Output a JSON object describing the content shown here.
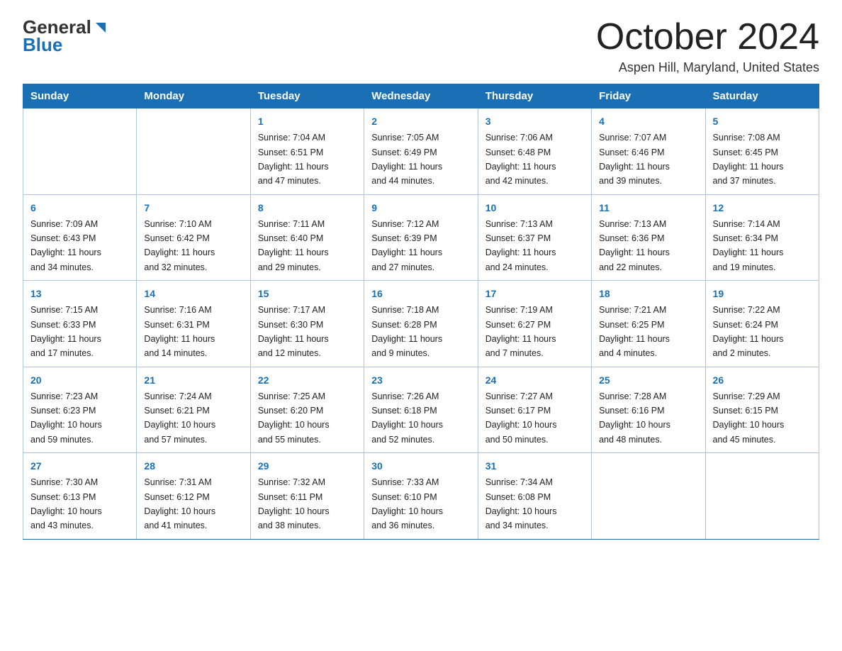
{
  "header": {
    "logo_general": "General",
    "logo_blue": "Blue",
    "month_title": "October 2024",
    "location": "Aspen Hill, Maryland, United States"
  },
  "days_of_week": [
    "Sunday",
    "Monday",
    "Tuesday",
    "Wednesday",
    "Thursday",
    "Friday",
    "Saturday"
  ],
  "weeks": [
    [
      {
        "day": "",
        "info": ""
      },
      {
        "day": "",
        "info": ""
      },
      {
        "day": "1",
        "info": "Sunrise: 7:04 AM\nSunset: 6:51 PM\nDaylight: 11 hours\nand 47 minutes."
      },
      {
        "day": "2",
        "info": "Sunrise: 7:05 AM\nSunset: 6:49 PM\nDaylight: 11 hours\nand 44 minutes."
      },
      {
        "day": "3",
        "info": "Sunrise: 7:06 AM\nSunset: 6:48 PM\nDaylight: 11 hours\nand 42 minutes."
      },
      {
        "day": "4",
        "info": "Sunrise: 7:07 AM\nSunset: 6:46 PM\nDaylight: 11 hours\nand 39 minutes."
      },
      {
        "day": "5",
        "info": "Sunrise: 7:08 AM\nSunset: 6:45 PM\nDaylight: 11 hours\nand 37 minutes."
      }
    ],
    [
      {
        "day": "6",
        "info": "Sunrise: 7:09 AM\nSunset: 6:43 PM\nDaylight: 11 hours\nand 34 minutes."
      },
      {
        "day": "7",
        "info": "Sunrise: 7:10 AM\nSunset: 6:42 PM\nDaylight: 11 hours\nand 32 minutes."
      },
      {
        "day": "8",
        "info": "Sunrise: 7:11 AM\nSunset: 6:40 PM\nDaylight: 11 hours\nand 29 minutes."
      },
      {
        "day": "9",
        "info": "Sunrise: 7:12 AM\nSunset: 6:39 PM\nDaylight: 11 hours\nand 27 minutes."
      },
      {
        "day": "10",
        "info": "Sunrise: 7:13 AM\nSunset: 6:37 PM\nDaylight: 11 hours\nand 24 minutes."
      },
      {
        "day": "11",
        "info": "Sunrise: 7:13 AM\nSunset: 6:36 PM\nDaylight: 11 hours\nand 22 minutes."
      },
      {
        "day": "12",
        "info": "Sunrise: 7:14 AM\nSunset: 6:34 PM\nDaylight: 11 hours\nand 19 minutes."
      }
    ],
    [
      {
        "day": "13",
        "info": "Sunrise: 7:15 AM\nSunset: 6:33 PM\nDaylight: 11 hours\nand 17 minutes."
      },
      {
        "day": "14",
        "info": "Sunrise: 7:16 AM\nSunset: 6:31 PM\nDaylight: 11 hours\nand 14 minutes."
      },
      {
        "day": "15",
        "info": "Sunrise: 7:17 AM\nSunset: 6:30 PM\nDaylight: 11 hours\nand 12 minutes."
      },
      {
        "day": "16",
        "info": "Sunrise: 7:18 AM\nSunset: 6:28 PM\nDaylight: 11 hours\nand 9 minutes."
      },
      {
        "day": "17",
        "info": "Sunrise: 7:19 AM\nSunset: 6:27 PM\nDaylight: 11 hours\nand 7 minutes."
      },
      {
        "day": "18",
        "info": "Sunrise: 7:21 AM\nSunset: 6:25 PM\nDaylight: 11 hours\nand 4 minutes."
      },
      {
        "day": "19",
        "info": "Sunrise: 7:22 AM\nSunset: 6:24 PM\nDaylight: 11 hours\nand 2 minutes."
      }
    ],
    [
      {
        "day": "20",
        "info": "Sunrise: 7:23 AM\nSunset: 6:23 PM\nDaylight: 10 hours\nand 59 minutes."
      },
      {
        "day": "21",
        "info": "Sunrise: 7:24 AM\nSunset: 6:21 PM\nDaylight: 10 hours\nand 57 minutes."
      },
      {
        "day": "22",
        "info": "Sunrise: 7:25 AM\nSunset: 6:20 PM\nDaylight: 10 hours\nand 55 minutes."
      },
      {
        "day": "23",
        "info": "Sunrise: 7:26 AM\nSunset: 6:18 PM\nDaylight: 10 hours\nand 52 minutes."
      },
      {
        "day": "24",
        "info": "Sunrise: 7:27 AM\nSunset: 6:17 PM\nDaylight: 10 hours\nand 50 minutes."
      },
      {
        "day": "25",
        "info": "Sunrise: 7:28 AM\nSunset: 6:16 PM\nDaylight: 10 hours\nand 48 minutes."
      },
      {
        "day": "26",
        "info": "Sunrise: 7:29 AM\nSunset: 6:15 PM\nDaylight: 10 hours\nand 45 minutes."
      }
    ],
    [
      {
        "day": "27",
        "info": "Sunrise: 7:30 AM\nSunset: 6:13 PM\nDaylight: 10 hours\nand 43 minutes."
      },
      {
        "day": "28",
        "info": "Sunrise: 7:31 AM\nSunset: 6:12 PM\nDaylight: 10 hours\nand 41 minutes."
      },
      {
        "day": "29",
        "info": "Sunrise: 7:32 AM\nSunset: 6:11 PM\nDaylight: 10 hours\nand 38 minutes."
      },
      {
        "day": "30",
        "info": "Sunrise: 7:33 AM\nSunset: 6:10 PM\nDaylight: 10 hours\nand 36 minutes."
      },
      {
        "day": "31",
        "info": "Sunrise: 7:34 AM\nSunset: 6:08 PM\nDaylight: 10 hours\nand 34 minutes."
      },
      {
        "day": "",
        "info": ""
      },
      {
        "day": "",
        "info": ""
      }
    ]
  ]
}
